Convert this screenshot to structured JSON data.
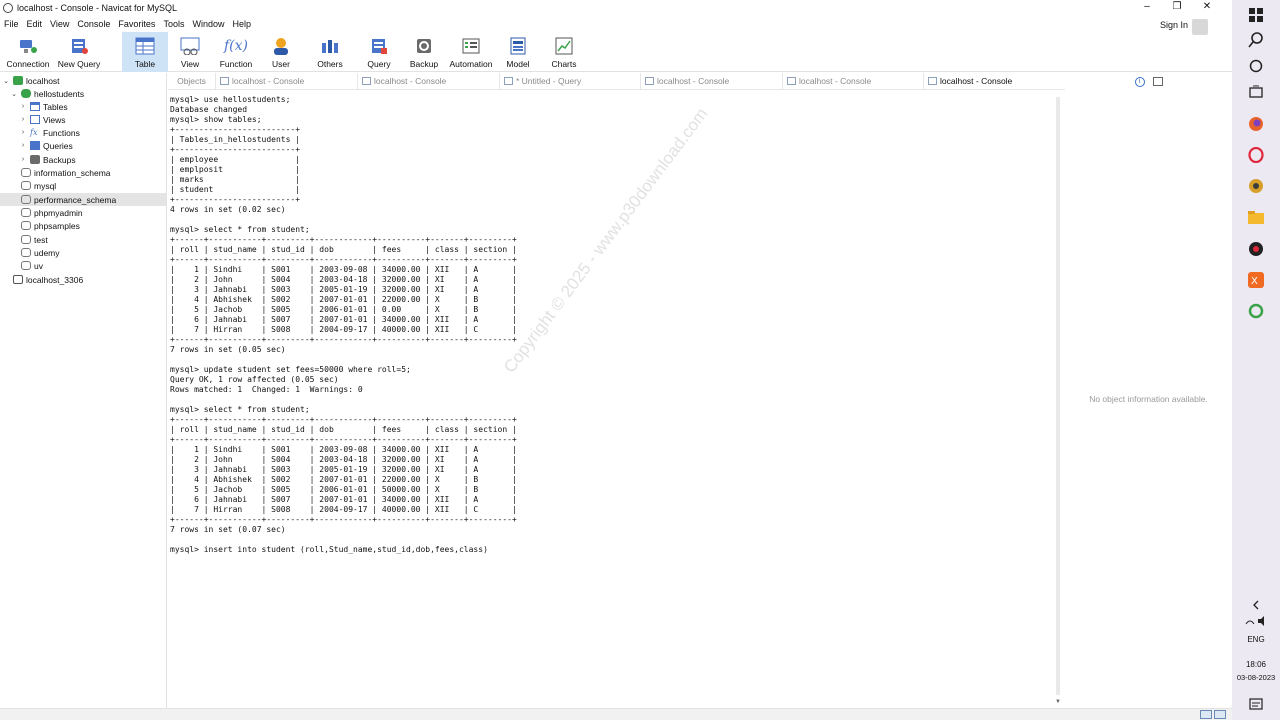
{
  "window": {
    "title": "localhost - Console - Navicat for MySQL",
    "min": "–",
    "restore": "❐",
    "close": "✕"
  },
  "menu": [
    "File",
    "Edit",
    "View",
    "Console",
    "Favorites",
    "Tools",
    "Window",
    "Help"
  ],
  "signin": "Sign In",
  "toolbar": {
    "connection": "Connection",
    "new_query": "New Query",
    "table": "Table",
    "view": "View",
    "function": "Function",
    "user": "User",
    "others": "Others",
    "query": "Query",
    "backup": "Backup",
    "automation": "Automation",
    "model": "Model",
    "charts": "Charts"
  },
  "tabs": [
    "Objects",
    "localhost - Console",
    "localhost - Console",
    "* Untitled - Query",
    "localhost - Console",
    "localhost - Console",
    "localhost - Console"
  ],
  "tree": {
    "localhost": "localhost",
    "hellostudents": "hellostudents",
    "tables": "Tables",
    "views": "Views",
    "functions": "Functions",
    "queries": "Queries",
    "backups": "Backups",
    "dbs": [
      "information_schema",
      "mysql",
      "performance_schema",
      "phpmyadmin",
      "phpsamples",
      "test",
      "udemy",
      "uv"
    ],
    "localhost_3306": "localhost_3306"
  },
  "console_text": "mysql> use hellostudents;\nDatabase changed\nmysql> show tables;\n+-------------------------+\n| Tables_in_hellostudents |\n+-------------------------+\n| employee                |\n| emplposit               |\n| marks                   |\n| student                 |\n+-------------------------+\n4 rows in set (0.02 sec)\n\nmysql> select * from student;\n+------+-----------+---------+------------+----------+-------+---------+\n| roll | stud_name | stud_id | dob        | fees     | class | section |\n+------+-----------+---------+------------+----------+-------+---------+\n|    1 | Sindhi    | S001    | 2003-09-08 | 34000.00 | XII   | A       |\n|    2 | John      | S004    | 2003-04-18 | 32000.00 | XI    | A       |\n|    3 | Jahnabi   | S003    | 2005-01-19 | 32000.00 | XI    | A       |\n|    4 | Abhishek  | S002    | 2007-01-01 | 22000.00 | X     | B       |\n|    5 | Jachob    | S005    | 2006-01-01 | 0.00     | X     | B       |\n|    6 | Jahnabi   | S007    | 2007-01-01 | 34000.00 | XII   | A       |\n|    7 | Hirran    | S008    | 2004-09-17 | 40000.00 | XII   | C       |\n+------+-----------+---------+------------+----------+-------+---------+\n7 rows in set (0.05 sec)\n\nmysql> update student set fees=50000 where roll=5;\nQuery OK, 1 row affected (0.05 sec)\nRows matched: 1  Changed: 1  Warnings: 0\n\nmysql> select * from student;\n+------+-----------+---------+------------+----------+-------+---------+\n| roll | stud_name | stud_id | dob        | fees     | class | section |\n+------+-----------+---------+------------+----------+-------+---------+\n|    1 | Sindhi    | S001    | 2003-09-08 | 34000.00 | XII   | A       |\n|    2 | John      | S004    | 2003-04-18 | 32000.00 | XI    | A       |\n|    3 | Jahnabi   | S003    | 2005-01-19 | 32000.00 | XI    | A       |\n|    4 | Abhishek  | S002    | 2007-01-01 | 22000.00 | X     | B       |\n|    5 | Jachob    | S005    | 2006-01-01 | 50000.00 | X     | B       |\n|    6 | Jahnabi   | S007    | 2007-01-01 | 34000.00 | XII   | A       |\n|    7 | Hirran    | S008    | 2004-09-17 | 40000.00 | XII   | C       |\n+------+-----------+---------+------------+----------+-------+---------+\n7 rows in set (0.07 sec)\n\nmysql> insert into student (roll,Stud_name,stud_id,dob,fees,class)",
  "watermark": "Copyright © 2025 - www.p30download.com",
  "info_panel": "No object information available.",
  "system": {
    "lang": "ENG",
    "time": "18:06",
    "date": "03-08-2023"
  }
}
